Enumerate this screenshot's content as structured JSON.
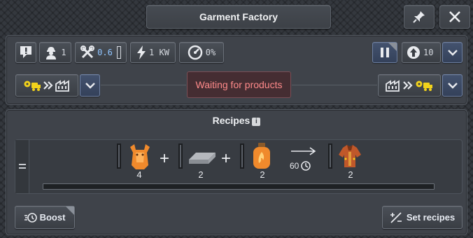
{
  "window": {
    "title": "Garment Factory",
    "pin_icon": "pin-icon",
    "close_icon": "close-icon"
  },
  "toolbar": {
    "notice_icon": "notification-icon",
    "workers": {
      "icon": "worker-icon",
      "value": "1"
    },
    "maintenance": {
      "icon": "wrench-icon",
      "value": "0.6"
    },
    "electricity": {
      "icon": "lightning-icon",
      "value": "1 KW"
    },
    "utilization": {
      "icon": "speed-gauge-icon",
      "value": "0%"
    },
    "pause_icon": "pause-icon",
    "priority": {
      "icon": "up-arrow-icon",
      "value": "10"
    }
  },
  "logistics": {
    "input_mode": "trucks-to-building",
    "output_mode": "building-to-trucks",
    "status": "Waiting for products",
    "status_color": "#ff8a8a"
  },
  "recipes": {
    "title": "Recipes",
    "items": [
      {
        "input_1": {
          "icon": "animal-hide-icon",
          "count": "4"
        },
        "input_2": {
          "icon": "fabric-sheet-icon",
          "count": "2"
        },
        "input_3": {
          "icon": "gas-canister-icon",
          "count": "2"
        },
        "duration": "60",
        "output": {
          "icon": "garment-icon",
          "count": "2"
        }
      }
    ]
  },
  "footer": {
    "boost_label": "Boost",
    "set_recipes_label": "Set recipes"
  },
  "colors": {
    "accent_blue": "#8fc4ff",
    "icon_yellow": "#f2d21b",
    "hide_orange": "#f08a2c"
  }
}
